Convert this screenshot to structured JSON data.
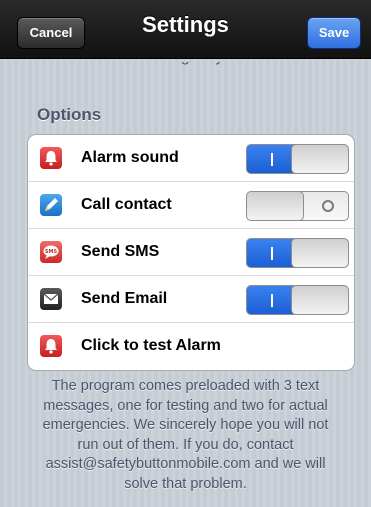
{
  "navbar": {
    "title": "Settings",
    "cancel_label": "Cancel",
    "save_label": "Save"
  },
  "clipped_text": "emergency.",
  "options": {
    "header": "Options",
    "items": [
      {
        "label": "Alarm sound",
        "icon": "alarm-bell-icon",
        "toggle": "on"
      },
      {
        "label": "Call contact",
        "icon": "phone-pencil-icon",
        "toggle": "off"
      },
      {
        "label": "Send SMS",
        "icon": "sms-bubble-icon",
        "toggle": "on"
      },
      {
        "label": "Send Email",
        "icon": "envelope-icon",
        "toggle": "on"
      },
      {
        "label": "Click to test Alarm",
        "icon": "alarm-bell-icon",
        "toggle": null
      }
    ]
  },
  "footer": {
    "lines": [
      "The program comes preloaded with 3 text",
      "messages, one for testing and two for actual",
      "emergencies. We sincerely hope you will not",
      "run out of them. If you do, contact",
      "assist@safetybuttonmobile.com and we will",
      "solve that problem."
    ]
  },
  "colors": {
    "toggle_on": "#2f73e4",
    "save_button": "#3b7cee",
    "navbar": "#1a1a1a",
    "background": "#c5ccd4"
  }
}
